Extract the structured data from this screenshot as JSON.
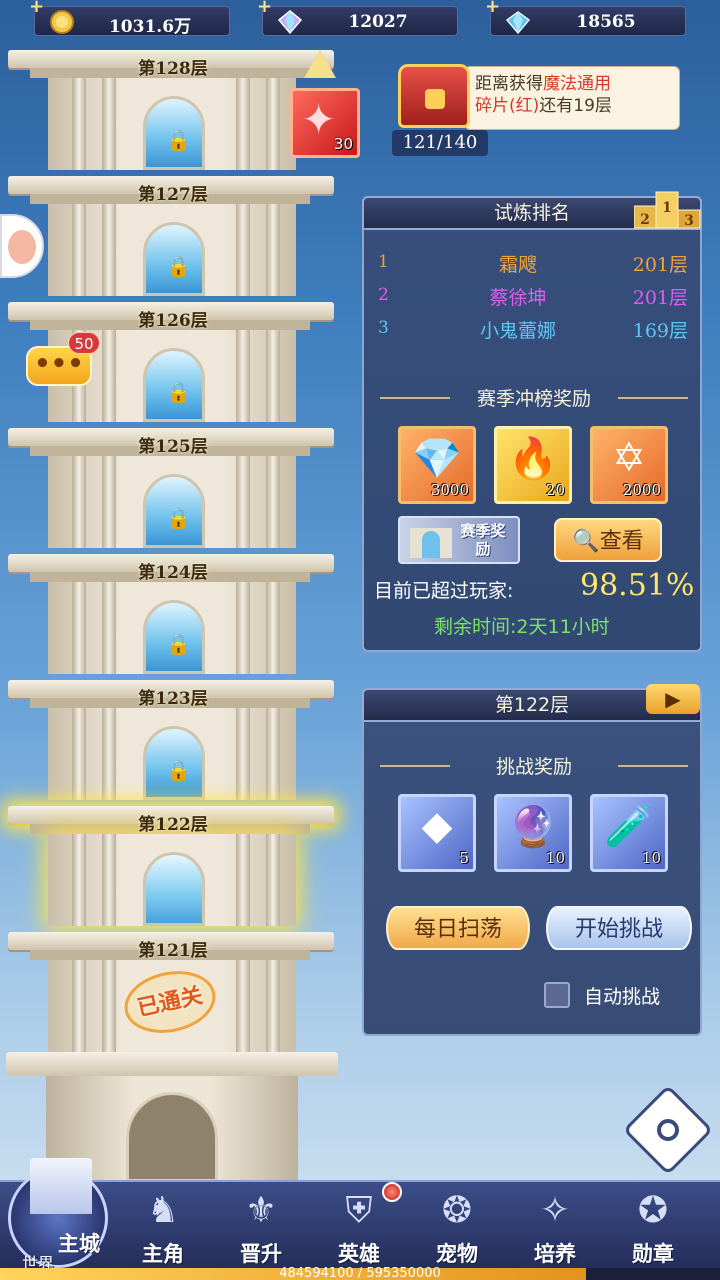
{
  "currencies": [
    {
      "icon": "gold-coin-icon",
      "value": "1031.6万"
    },
    {
      "icon": "rainbow-diamond-icon",
      "value": "12027"
    },
    {
      "icon": "blue-diamond-icon",
      "value": "18565"
    }
  ],
  "tower": {
    "floors": [
      {
        "label": "第128层",
        "state": "locked"
      },
      {
        "label": "第127层",
        "state": "locked"
      },
      {
        "label": "第126层",
        "state": "locked"
      },
      {
        "label": "第125层",
        "state": "locked"
      },
      {
        "label": "第124层",
        "state": "locked"
      },
      {
        "label": "第123层",
        "state": "locked"
      },
      {
        "label": "第122层",
        "state": "current"
      },
      {
        "label": "第121层",
        "state": "cleared"
      }
    ],
    "cleared_stamp": "已通关"
  },
  "puzzle_reward": {
    "count": "30"
  },
  "chat": {
    "badge": "50"
  },
  "milestone": {
    "prefix": "距离获得",
    "highlight1": "魔法通用",
    "highlight2": "碎片(红)",
    "suffix": "还有19层",
    "progress": "121/140"
  },
  "ranking": {
    "title": "试炼排名",
    "rows": [
      {
        "rank": "1",
        "name": "霜飕",
        "floor": "201层",
        "color": "#f0a33a"
      },
      {
        "rank": "2",
        "name": "蔡徐坤",
        "floor": "201层",
        "color": "#e05cf0"
      },
      {
        "rank": "3",
        "name": "小鬼蕾娜",
        "floor": "169层",
        "color": "#5ec6f2"
      }
    ],
    "season_reward_title": "赛季冲榜奖励",
    "season_items": [
      {
        "icon": "rainbow-diamond-icon",
        "qty": "3000"
      },
      {
        "icon": "flame-icon",
        "qty": "20"
      },
      {
        "icon": "star-emblem-icon",
        "qty": "2000"
      }
    ],
    "season_banner": "赛季奖励",
    "view_label": "查看",
    "beat_label": "目前已超过玩家:",
    "beat_value": "98.51%",
    "remaining_label": "剩余时间:",
    "remaining_value": "2天11小时"
  },
  "challenge": {
    "title": "第122层",
    "reward_title": "挑战奖励",
    "items": [
      {
        "icon": "exp-crystal-icon",
        "qty": "5"
      },
      {
        "icon": "crystal-ball-icon",
        "qty": "10"
      },
      {
        "icon": "potion-icon",
        "qty": "10"
      }
    ],
    "sweep_label": "每日扫荡",
    "start_label": "开始挑战",
    "auto_label": "自动挑战"
  },
  "nav": {
    "city_main": "主城",
    "city_sub": "世界",
    "items": [
      {
        "label": "主角",
        "icon": "hero-icon"
      },
      {
        "label": "晋升",
        "icon": "promote-icon"
      },
      {
        "label": "英雄",
        "icon": "helmet-icon"
      },
      {
        "label": "宠物",
        "icon": "pet-icon"
      },
      {
        "label": "培养",
        "icon": "cultivate-icon"
      },
      {
        "label": "勋章",
        "icon": "medal-icon"
      }
    ],
    "exp_text": "484594100 / 595350000",
    "exp_fraction": 0.814
  }
}
